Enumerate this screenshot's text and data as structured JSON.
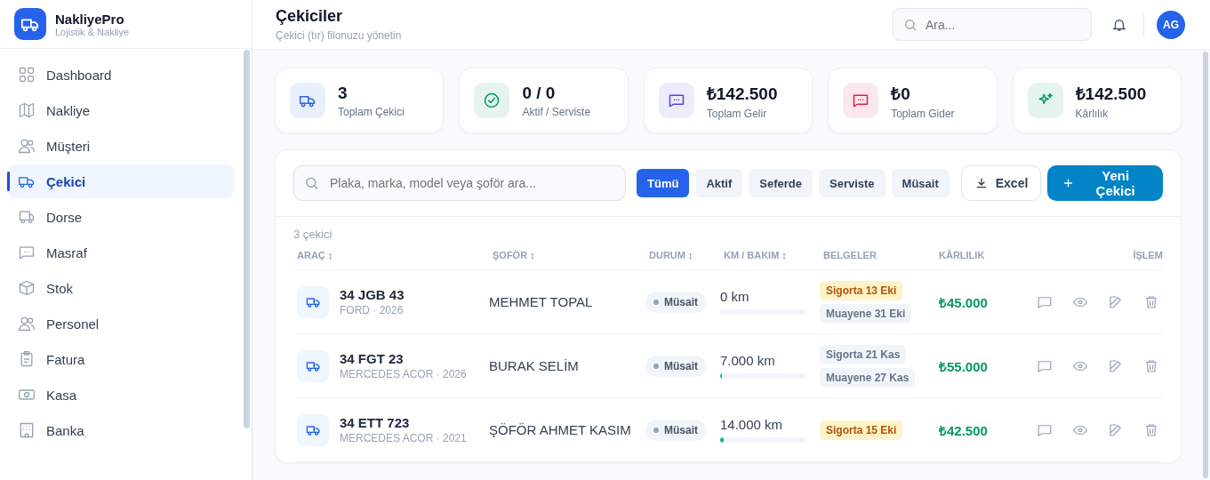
{
  "brand": {
    "name": "NakliyePro",
    "tagline": "Lojistik & Nakliye"
  },
  "sidebar": {
    "items": [
      {
        "label": "Dashboard",
        "selected": false
      },
      {
        "label": "Nakliye",
        "selected": false
      },
      {
        "label": "Müşteri",
        "selected": false
      },
      {
        "label": "Çekici",
        "selected": true
      },
      {
        "label": "Dorse",
        "selected": false
      },
      {
        "label": "Masraf",
        "selected": false
      },
      {
        "label": "Stok",
        "selected": false
      },
      {
        "label": "Personel",
        "selected": false
      },
      {
        "label": "Fatura",
        "selected": false
      },
      {
        "label": "Kasa",
        "selected": false
      },
      {
        "label": "Banka",
        "selected": false
      }
    ]
  },
  "header": {
    "title": "Çekiciler",
    "subtitle": "Çekici (tır) filonuzu yönetin",
    "search_placeholder": "Ara...",
    "avatar": "AG"
  },
  "stats": [
    {
      "value": "3",
      "label": "Toplam Çekici",
      "color": "#2563eb"
    },
    {
      "value": "0 / 0",
      "label": "Aktif / Serviste",
      "color": "#059669"
    },
    {
      "value": "₺142.500",
      "label": "Toplam Gelir",
      "color": "#4f46e5"
    },
    {
      "value": "₺0",
      "label": "Toplam Gider",
      "color": "#e11d48"
    },
    {
      "value": "₺142.500",
      "label": "Kârlılık",
      "color": "#059669"
    }
  ],
  "toolbar": {
    "search_placeholder": "Plaka, marka, model veya şoför ara...",
    "filters": [
      {
        "label": "Tümü",
        "selected": true
      },
      {
        "label": "Aktif",
        "selected": false
      },
      {
        "label": "Seferde",
        "selected": false
      },
      {
        "label": "Serviste",
        "selected": false
      },
      {
        "label": "Müsait",
        "selected": false
      }
    ],
    "export_button": "Excel",
    "new_button": "Yeni Çekici"
  },
  "table": {
    "count": "3 çekici",
    "columns": [
      {
        "label": "ARAÇ",
        "sort_icon": "↕"
      },
      {
        "label": "ŞOFÖR",
        "sort_icon": "↕"
      },
      {
        "label": "DURUM",
        "sort_icon": "↕"
      },
      {
        "label": "KM / BAKIM",
        "sort_icon": "↕"
      },
      {
        "label": "BELGELER"
      },
      {
        "label": "KÂRLILIK"
      },
      {
        "label": "İŞLEM"
      }
    ],
    "rows": [
      {
        "plate": "34 JGB 43",
        "model": "FORD · 2026",
        "driver": "MEHMET TOPAL",
        "status": "Müsait",
        "km": "0 km",
        "level": 0,
        "documents": [
          {
            "label": "Sigorta 13 Eki",
            "kind": "warning"
          },
          {
            "label": "Muayene 31 Eki",
            "kind": "neutral"
          }
        ],
        "profit": "₺45.000"
      },
      {
        "plate": "34 FGT 23",
        "model": "MERCEDES ACOR · 2026",
        "driver": "BURAK SELİM",
        "status": "Müsait",
        "km": "7.000 km",
        "level": 0.02,
        "documents": [
          {
            "label": "Sigorta 21 Kas",
            "kind": "neutral"
          },
          {
            "label": "Muayene 27 Kas",
            "kind": "neutral"
          }
        ],
        "profit": "₺55.000"
      },
      {
        "plate": "34 ETT 723",
        "model": "MERCEDES ACOR · 2021",
        "driver": "ŞÖFÖR AHMET KASIM",
        "status": "Müsait",
        "km": "14.000 km",
        "level": 0.04,
        "documents": [
          {
            "label": "Sigorta 15 Eki",
            "kind": "warning"
          }
        ],
        "profit": "₺42.500"
      }
    ]
  }
}
